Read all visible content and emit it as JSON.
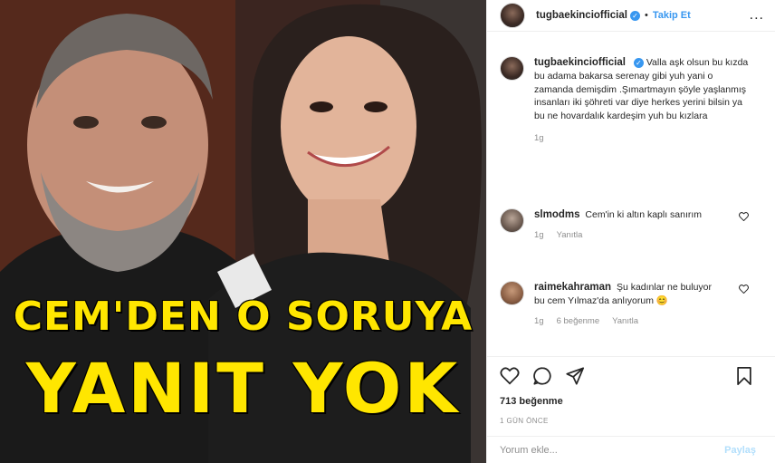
{
  "photo": {
    "headline_line1": "CEM'DEN O SORUYA",
    "headline_line2": "YANIT YOK",
    "headline_color": "#ffe600"
  },
  "header": {
    "username": "tugbaekinciofficial",
    "verified_icon": "verified-badge-icon",
    "separator": "•",
    "follow_label": "Takip Et",
    "more_icon": "more-options-icon",
    "more_label": "..."
  },
  "caption": {
    "username": "tugbaekinciofficial",
    "text": "Valla aşk olsun bu kızda bu adama bakarsa serenay gibi yuh yani o zamanda demişdim .Şımartmayın şöyle yaşlanmış insanları iki şöhreti var diye herkes yerini bilsin ya bu ne hovardalık kardeşim yuh bu kızlara",
    "time": "1g"
  },
  "comments": [
    {
      "username": "slmodms",
      "text": "Cem'in ki altın kaplı sanırım",
      "time": "1g",
      "likes": "",
      "reply_label": "Yanıtla"
    },
    {
      "username": "raimekahraman",
      "text": "Şu kadınlar ne buluyor bu cem Yılmaz'da anlıyorum 😊",
      "time": "1g",
      "likes": "6 beğenme",
      "reply_label": "Yanıtla"
    }
  ],
  "actions": {
    "icons": [
      "heart-icon",
      "comment-icon",
      "share-icon",
      "bookmark-icon"
    ]
  },
  "likes_text": "713 beğenme",
  "timestamp": "1 GÜN ÖNCE",
  "add_comment": {
    "placeholder": "Yorum ekle...",
    "post_label": "Paylaş"
  },
  "colors": {
    "accent": "#3897f0",
    "muted": "#8e8e8e",
    "post_disabled": "#b2dffc"
  }
}
